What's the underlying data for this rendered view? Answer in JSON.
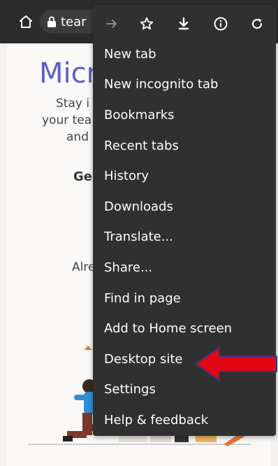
{
  "browser": {
    "url_text": "tear",
    "icons": {
      "home": "home-icon",
      "lock": "lock-icon"
    }
  },
  "background_page": {
    "title": "Micr",
    "line1": "Stay i",
    "line2": "your tea",
    "line3": "and",
    "get_started": "Ge",
    "already": "Alre"
  },
  "menu": {
    "toolbar_icons": [
      "forward-icon",
      "star-icon",
      "download-icon",
      "info-icon",
      "refresh-icon"
    ],
    "items": [
      {
        "label": "New tab"
      },
      {
        "label": "New incognito tab"
      },
      {
        "label": "Bookmarks"
      },
      {
        "label": "Recent tabs"
      },
      {
        "label": "History"
      },
      {
        "label": "Downloads"
      },
      {
        "label": "Translate..."
      },
      {
        "label": "Share..."
      },
      {
        "label": "Find in page"
      },
      {
        "label": "Add to Home screen"
      },
      {
        "label": "Desktop site"
      },
      {
        "label": "Settings"
      },
      {
        "label": "Help & feedback"
      }
    ]
  },
  "colors": {
    "menu_bg": "#303030",
    "topbar_bg": "#2b2b2b",
    "brand_purple": "#5b5fc7",
    "annotation_red": "#e30613"
  }
}
